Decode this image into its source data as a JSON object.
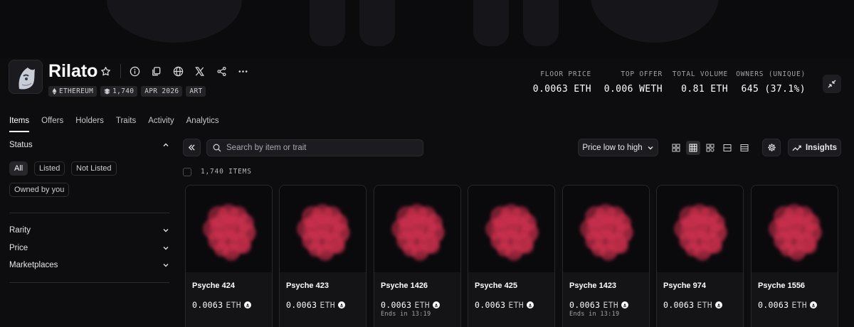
{
  "collection": {
    "name": "Rilato",
    "chips": [
      {
        "icon": "ethereum-icon",
        "label": "ETHEREUM"
      },
      {
        "icon": "stack-icon",
        "label": "1,740"
      },
      {
        "icon": "",
        "label": "APR 2026"
      },
      {
        "icon": "",
        "label": "ART"
      }
    ]
  },
  "stats": [
    {
      "label": "FLOOR PRICE",
      "value": "0.0063 ETH"
    },
    {
      "label": "TOP OFFER",
      "value": "0.006 WETH"
    },
    {
      "label": "TOTAL VOLUME",
      "value": "0.81 ETH"
    },
    {
      "label": "OWNERS (UNIQUE)",
      "value": "645 (37.1%)"
    }
  ],
  "tabs": [
    "Items",
    "Offers",
    "Holders",
    "Traits",
    "Activity",
    "Analytics"
  ],
  "sidebar": {
    "status_title": "Status",
    "status_options": [
      "All",
      "Listed",
      "Not Listed",
      "Owned by you"
    ],
    "filters": [
      "Rarity",
      "Price",
      "Marketplaces"
    ]
  },
  "toolbar": {
    "search_placeholder": "Search by item or trait",
    "sort_label": "Price low to high",
    "insights_label": "Insights",
    "items_count": "1,740 ITEMS"
  },
  "items": [
    {
      "name": "Psyche 424",
      "price": "0.0063",
      "unit": "ETH",
      "ends": ""
    },
    {
      "name": "Psyche 423",
      "price": "0.0063",
      "unit": "ETH",
      "ends": ""
    },
    {
      "name": "Psyche 1426",
      "price": "0.0063",
      "unit": "ETH",
      "ends": "Ends in 13:19"
    },
    {
      "name": "Psyche 425",
      "price": "0.0063",
      "unit": "ETH",
      "ends": ""
    },
    {
      "name": "Psyche 1423",
      "price": "0.0063",
      "unit": "ETH",
      "ends": "Ends in 13:19"
    },
    {
      "name": "Psyche 974",
      "price": "0.0063",
      "unit": "ETH",
      "ends": ""
    },
    {
      "name": "Psyche 1556",
      "price": "0.0063",
      "unit": "ETH",
      "ends": ""
    }
  ],
  "colors": {
    "background": "#0d0d0f",
    "artwork": "#d2324f"
  }
}
